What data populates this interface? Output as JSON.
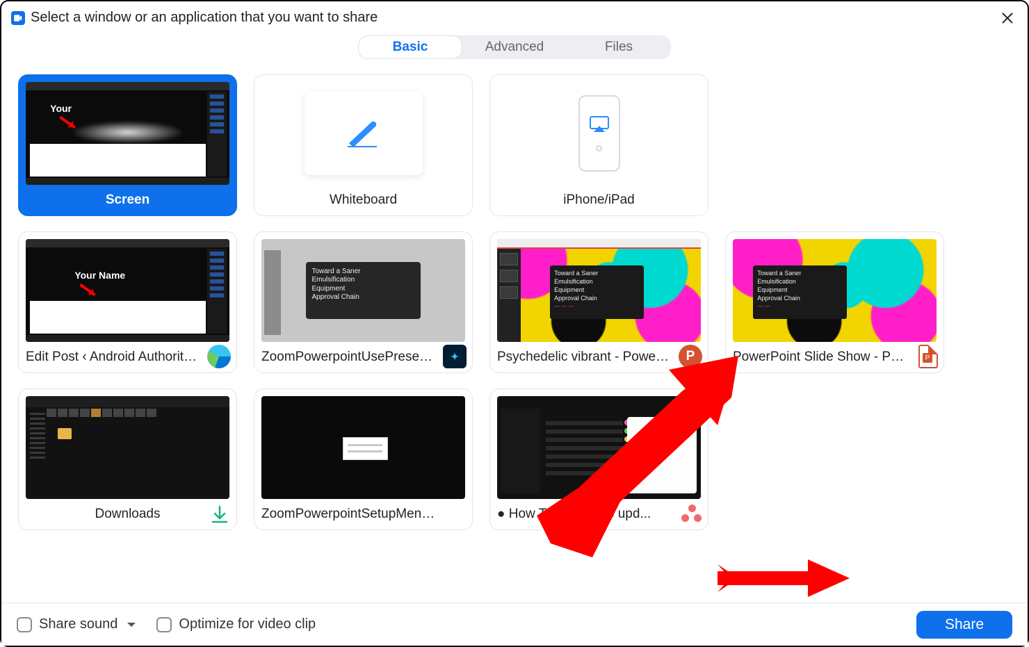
{
  "header": {
    "title": "Select a window or an application that you want to share"
  },
  "tabs": {
    "basic": "Basic",
    "advanced": "Advanced",
    "files": "Files"
  },
  "options": {
    "screen": "Screen",
    "whiteboard": "Whiteboard",
    "iphone": "iPhone/iPad"
  },
  "slide_text": {
    "l1": "Toward a Saner",
    "l2": "Emulsification",
    "l3": "Equipment",
    "l4": "Approval Chain"
  },
  "desktop": {
    "your": "Your",
    "your_name": "Your Name"
  },
  "windows": [
    "Edit Post ‹ Android Authority — ...",
    "ZoomPowerpointUsePresenterVie...",
    "Psychedelic vibrant - PowerPoint",
    "PowerPoint Slide Show  -  Psyche...",
    "Downloads",
    "ZoomPowerpointSetupMenu.jpg ...",
    "● How To — How to upd..."
  ],
  "footer": {
    "share_sound": "Share sound",
    "optimize": "Optimize for video clip",
    "share": "Share"
  }
}
